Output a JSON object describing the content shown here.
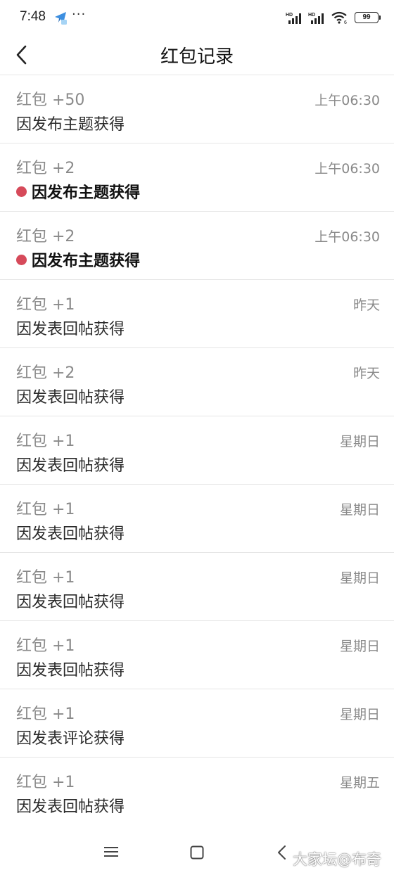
{
  "status_bar": {
    "time": "7:48",
    "more": "···",
    "battery": "99",
    "app_icon": "telegram-icon"
  },
  "header": {
    "title": "红包记录",
    "back_icon": "chevron-left-icon"
  },
  "records": [
    {
      "amount": "红包 +50",
      "time": "上午06:30",
      "reason": "因发布主题获得",
      "unread": false
    },
    {
      "amount": "红包 +2",
      "time": "上午06:30",
      "reason": "因发布主题获得",
      "unread": true
    },
    {
      "amount": "红包 +2",
      "time": "上午06:30",
      "reason": "因发布主题获得",
      "unread": true
    },
    {
      "amount": "红包 +1",
      "time": "昨天",
      "reason": "因发表回帖获得",
      "unread": false
    },
    {
      "amount": "红包 +2",
      "time": "昨天",
      "reason": "因发表回帖获得",
      "unread": false
    },
    {
      "amount": "红包 +1",
      "time": "星期日",
      "reason": "因发表回帖获得",
      "unread": false
    },
    {
      "amount": "红包 +1",
      "time": "星期日",
      "reason": "因发表回帖获得",
      "unread": false
    },
    {
      "amount": "红包 +1",
      "time": "星期日",
      "reason": "因发表回帖获得",
      "unread": false
    },
    {
      "amount": "红包 +1",
      "time": "星期日",
      "reason": "因发表回帖获得",
      "unread": false
    },
    {
      "amount": "红包 +1",
      "time": "星期日",
      "reason": "因发表评论获得",
      "unread": false
    },
    {
      "amount": "红包 +1",
      "time": "星期五",
      "reason": "因发表回帖获得",
      "unread": false
    }
  ],
  "colors": {
    "unread_dot": "#d64a5a",
    "secondary_text": "#8a8a8a",
    "divider": "#e6e6e6"
  },
  "watermark": "大家坛@布奇"
}
